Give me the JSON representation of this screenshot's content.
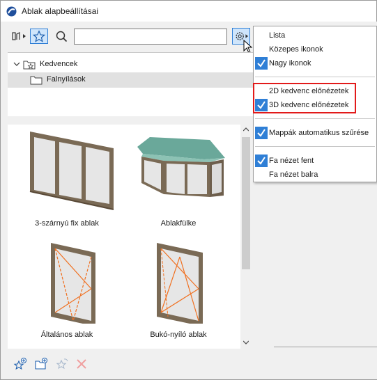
{
  "window": {
    "title": "Ablak alapbeállításai"
  },
  "search": {
    "value": "",
    "placeholder": ""
  },
  "tree": {
    "root_label": "Kedvencek",
    "child_label": "Falnyílások"
  },
  "items": [
    {
      "label": "3-szárnyú fix ablak"
    },
    {
      "label": "Ablakfülke"
    },
    {
      "label": "Általános ablak"
    },
    {
      "label": "Bukó-nyíló ablak"
    }
  ],
  "menu": {
    "items": [
      {
        "label": "Lista",
        "checked": false
      },
      {
        "label": "Közepes ikonok",
        "checked": false
      },
      {
        "label": "Nagy ikonok",
        "checked": true
      },
      {
        "label": "2D kedvenc előnézetek",
        "checked": false
      },
      {
        "label": "3D kedvenc előnézetek",
        "checked": true
      },
      {
        "label": "Mappák automatikus szűrése",
        "checked": true
      },
      {
        "label": "Fa nézet fent",
        "checked": true
      },
      {
        "label": "Fa nézet balra",
        "checked": false
      }
    ]
  },
  "colors": {
    "accent": "#2f7fd6",
    "highlight_border": "#e21a1a",
    "frame_brown": "#7a6a55",
    "glass": "#e6e6e6",
    "opening_line": "#f07020",
    "roof_green": "#6aa89a"
  }
}
